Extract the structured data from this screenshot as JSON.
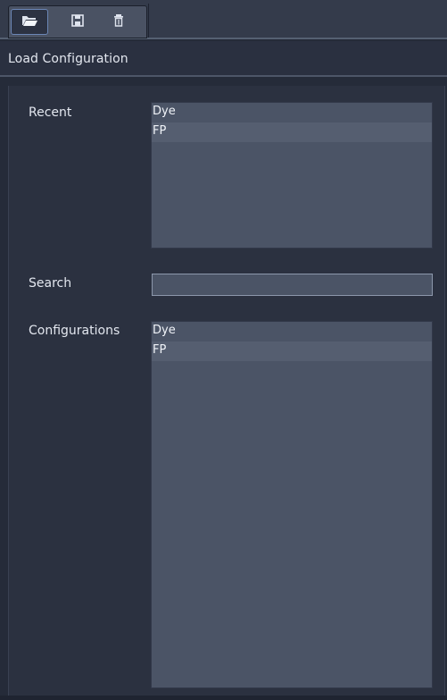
{
  "toolbar": {
    "buttons": [
      {
        "name": "open-folder-icon",
        "active": true
      },
      {
        "name": "save-icon",
        "active": false
      },
      {
        "name": "delete-icon",
        "active": false
      }
    ]
  },
  "header": {
    "title": "Load Configuration"
  },
  "recent": {
    "label": "Recent",
    "items": [
      "Dye",
      "FP"
    ]
  },
  "search": {
    "label": "Search",
    "value": ""
  },
  "configurations": {
    "label": "Configurations",
    "items": [
      "Dye",
      "FP"
    ]
  },
  "colors": {
    "panel_bg": "#252b39",
    "list_bg": "#4b5466",
    "list_highlight": "#555e70",
    "text": "#e3e7ef",
    "active_border": "#6b86b6"
  }
}
